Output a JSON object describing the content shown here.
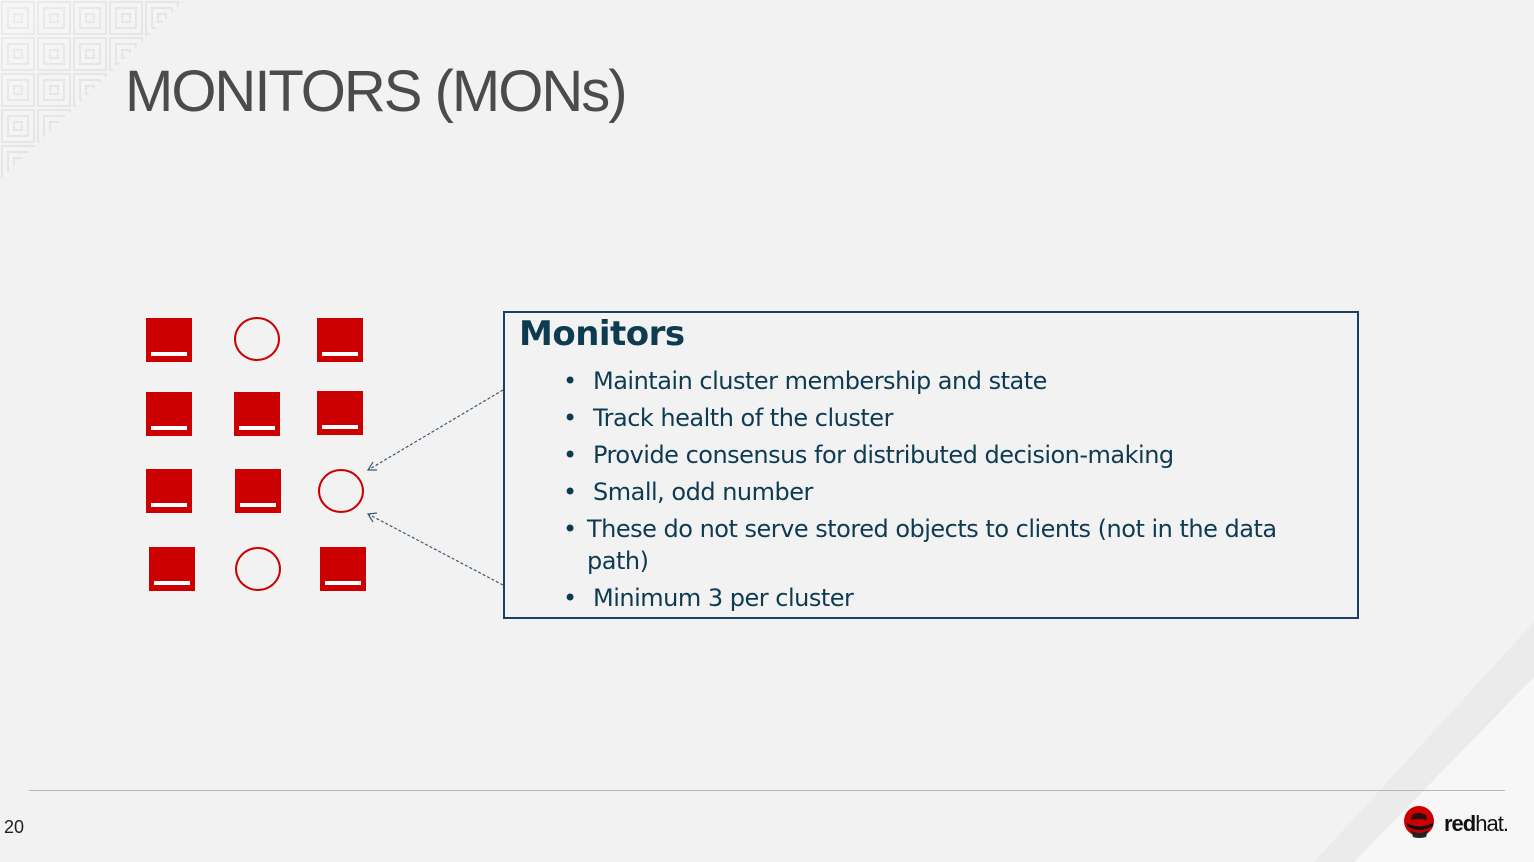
{
  "slide": {
    "title": "MONITORS (MONs)",
    "page_number": "20"
  },
  "diagram": {
    "nodes": [
      {
        "row": 1,
        "col": 1,
        "kind": "osd"
      },
      {
        "row": 1,
        "col": 2,
        "kind": "monitor"
      },
      {
        "row": 1,
        "col": 3,
        "kind": "osd"
      },
      {
        "row": 2,
        "col": 1,
        "kind": "osd"
      },
      {
        "row": 2,
        "col": 2,
        "kind": "osd"
      },
      {
        "row": 2,
        "col": 3,
        "kind": "osd"
      },
      {
        "row": 3,
        "col": 1,
        "kind": "osd"
      },
      {
        "row": 3,
        "col": 2,
        "kind": "osd"
      },
      {
        "row": 3,
        "col": 3,
        "kind": "monitor"
      },
      {
        "row": 4,
        "col": 1,
        "kind": "osd"
      },
      {
        "row": 4,
        "col": 2,
        "kind": "monitor"
      },
      {
        "row": 4,
        "col": 3,
        "kind": "osd"
      }
    ],
    "node_color": "#cc0000"
  },
  "monitors_box": {
    "title": "Monitors",
    "bullet_symbol": "•",
    "bullets": [
      "Maintain cluster membership and state",
      "Track health of the cluster",
      "Provide consensus for distributed decision-making",
      "Small, odd number",
      "These do not serve stored objects to clients (not in the data path)",
      "Minimum 3 per cluster"
    ],
    "text_color": "#0e3b52"
  },
  "brand": {
    "logo_text_bold": "red",
    "logo_text_light": "hat.",
    "logo_icon": "red-hat-shadowman-icon"
  }
}
